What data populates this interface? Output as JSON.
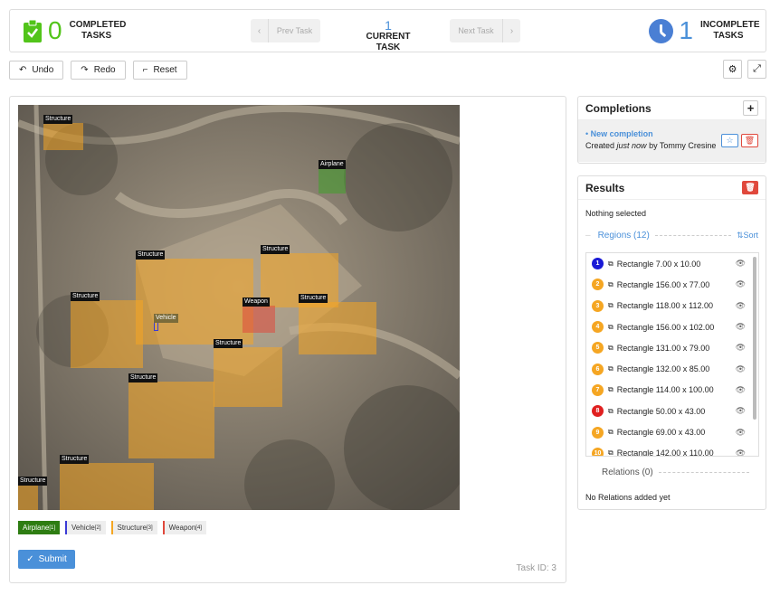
{
  "topbar": {
    "completed_count": "0",
    "completed_label": "COMPLETED TASKS",
    "prev_label": "Prev Task",
    "current_num": "1",
    "current_label": "CURRENT TASK",
    "next_label": "Next Task",
    "incomplete_count": "1",
    "incomplete_label": "INCOMPLETE TASKS"
  },
  "toolbar": {
    "undo": "Undo",
    "redo": "Redo",
    "reset": "Reset"
  },
  "regions_on_image": [
    {
      "label": "Structure",
      "color": "#f5a623"
    },
    {
      "label": "Airplane",
      "color": "#3fa02a"
    },
    {
      "label": "Structure",
      "color": "#f5a623"
    },
    {
      "label": "Structure",
      "color": "#f5a623"
    },
    {
      "label": "Structure",
      "color": "#f5a623"
    },
    {
      "label": "Structure",
      "color": "#f5a623"
    },
    {
      "label": "Weapon",
      "color": "#e0483c"
    },
    {
      "label": "Vehicle",
      "color": "#3b3bd6"
    },
    {
      "label": "Structure",
      "color": "#f5a623"
    },
    {
      "label": "Structure",
      "color": "#f5a623"
    },
    {
      "label": "Structure",
      "color": "#f5a623"
    },
    {
      "label": "Structure",
      "color": "#f5a623"
    }
  ],
  "legend": [
    {
      "name": "Airplane",
      "hotkey": "[1]",
      "color": "#2e7d12"
    },
    {
      "name": "Vehicle",
      "hotkey": "[2]",
      "color": "#3b3bd6"
    },
    {
      "name": "Structure",
      "hotkey": "[3]",
      "color": "#f5a623"
    },
    {
      "name": "Weapon",
      "hotkey": "[4]",
      "color": "#e0483c"
    }
  ],
  "submit_label": "Submit",
  "task_id": "Task ID: 3",
  "completions": {
    "title": "Completions",
    "item_title": "New completion",
    "created_prefix": "Created ",
    "created_when": "just now",
    "created_suffix": " by Tommy Cresine"
  },
  "results": {
    "title": "Results",
    "selection": "Nothing selected",
    "regions_label": "Regions (12)",
    "sort_label": "Sort",
    "items": [
      {
        "n": "1",
        "text": "Rectangle 7.00 x 10.00",
        "color": "#1a1ad6"
      },
      {
        "n": "2",
        "text": "Rectangle 156.00 x 77.00",
        "color": "#f5a623"
      },
      {
        "n": "3",
        "text": "Rectangle 118.00 x 112.00",
        "color": "#f5a623"
      },
      {
        "n": "4",
        "text": "Rectangle 156.00 x 102.00",
        "color": "#f5a623"
      },
      {
        "n": "5",
        "text": "Rectangle 131.00 x 79.00",
        "color": "#f5a623"
      },
      {
        "n": "6",
        "text": "Rectangle 132.00 x 85.00",
        "color": "#f5a623"
      },
      {
        "n": "7",
        "text": "Rectangle 114.00 x 100.00",
        "color": "#f5a623"
      },
      {
        "n": "8",
        "text": "Rectangle 50.00 x 43.00",
        "color": "#e02020"
      },
      {
        "n": "9",
        "text": "Rectangle 69.00 x 43.00",
        "color": "#f5a623"
      },
      {
        "n": "10",
        "text": "Rectangle 142.00 x 110.00",
        "color": "#f5a623"
      }
    ],
    "relations_label": "Relations (0)",
    "relations_empty": "No Relations added yet"
  }
}
